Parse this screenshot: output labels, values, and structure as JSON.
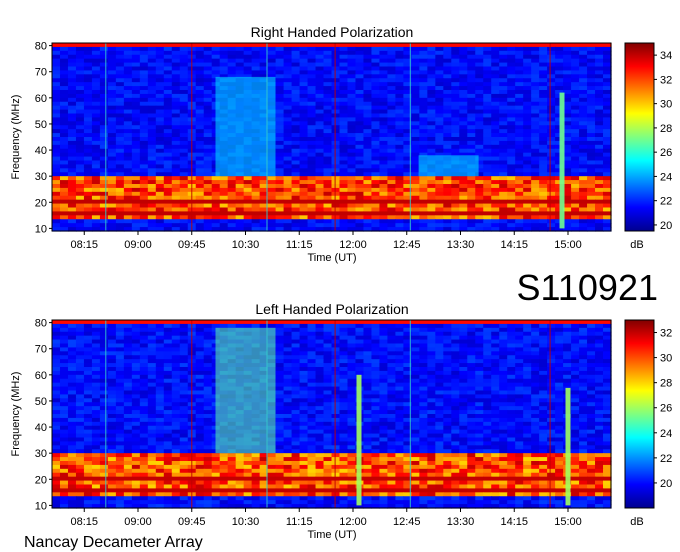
{
  "observation_id": "S110921",
  "source_label": "Nancay Decameter Array",
  "chart_data": [
    {
      "type": "heatmap",
      "title": "Right Handed Polarization",
      "xlabel": "Time (UT)",
      "ylabel": "Frequency (MHz)",
      "x_ticks": [
        "08:15",
        "09:00",
        "09:45",
        "10:30",
        "11:15",
        "12:00",
        "12:45",
        "13:30",
        "14:15",
        "15:00"
      ],
      "y_ticks": [
        10,
        20,
        30,
        40,
        50,
        60,
        70,
        80
      ],
      "ylim": [
        9,
        81
      ],
      "colorbar": {
        "label": "dB",
        "ticks": [
          20,
          22,
          24,
          26,
          28,
          30,
          32,
          34
        ],
        "range": [
          19.5,
          35
        ]
      },
      "features": [
        {
          "type": "band",
          "freq_range": [
            14,
            30
          ],
          "level_db": 34
        },
        {
          "type": "burst",
          "time": "10:30",
          "freq_range": [
            30,
            68
          ],
          "level_db": 25
        },
        {
          "type": "burst",
          "time": "13:20",
          "freq_range": [
            30,
            38
          ],
          "level_db": 25
        },
        {
          "type": "spike",
          "time": "14:55",
          "freq_range": [
            10,
            62
          ],
          "level_db": 27
        }
      ]
    },
    {
      "type": "heatmap",
      "title": "Left Handed Polarization",
      "xlabel": "Time (UT)",
      "ylabel": "Frequency (MHz)",
      "x_ticks": [
        "08:15",
        "09:00",
        "09:45",
        "10:30",
        "11:15",
        "12:00",
        "12:45",
        "13:30",
        "14:15",
        "15:00"
      ],
      "y_ticks": [
        10,
        20,
        30,
        40,
        50,
        60,
        70,
        80
      ],
      "ylim": [
        9,
        81
      ],
      "colorbar": {
        "label": "dB",
        "ticks": [
          20,
          22,
          24,
          26,
          28,
          30,
          32
        ],
        "range": [
          18,
          33
        ]
      },
      "features": [
        {
          "type": "band",
          "freq_range": [
            14,
            30
          ],
          "level_db": 32
        },
        {
          "type": "burst",
          "time": "10:30",
          "freq_range": [
            30,
            78
          ],
          "level_db": 25
        },
        {
          "type": "spike",
          "time": "12:05",
          "freq_range": [
            10,
            60
          ],
          "level_db": 26
        },
        {
          "type": "spike",
          "time": "15:00",
          "freq_range": [
            10,
            55
          ],
          "level_db": 26
        }
      ]
    }
  ]
}
